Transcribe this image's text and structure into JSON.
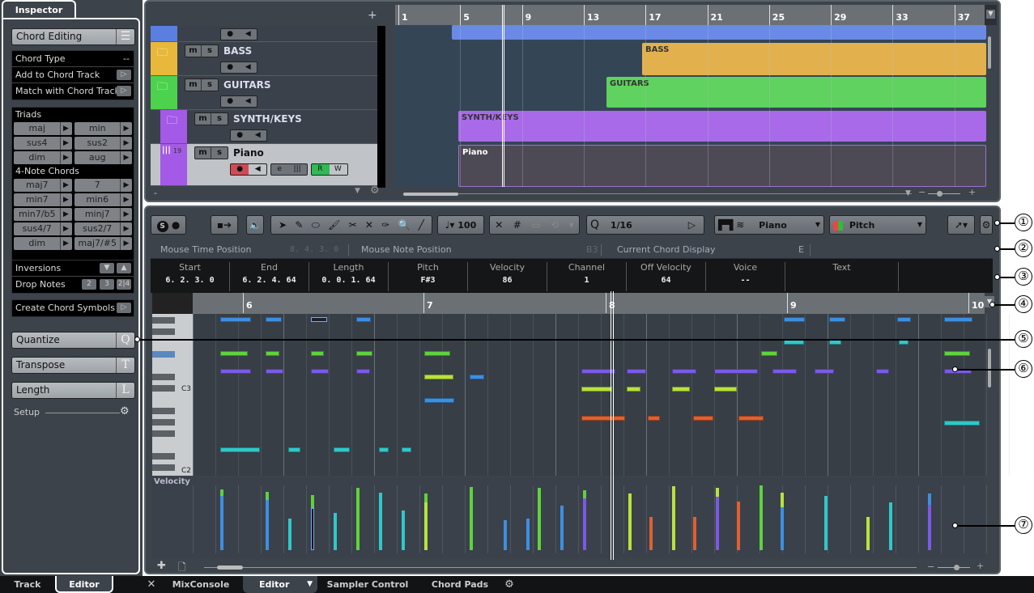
{
  "inspector": {
    "tab_label": "Inspector",
    "section_button": "Chord Editing",
    "chord_type_label": "Chord Type",
    "chord_type_value": "--",
    "add_to_chord_track": "Add to Chord Track",
    "match_with_chord_track": "Match with Chord Track",
    "triads_label": "Triads",
    "triads": [
      "maj",
      "min",
      "sus4",
      "sus2",
      "dim",
      "aug"
    ],
    "four_note_label": "4-Note Chords",
    "four_note_chords": [
      "maj7",
      "7",
      "min7",
      "min6",
      "min7/b5",
      "minj7",
      "sus4/7",
      "sus2/7",
      "dim",
      "maj7/#5"
    ],
    "inversions_label": "Inversions",
    "drop_notes_label": "Drop Notes",
    "drop_notes_options": [
      "2",
      "3",
      "2|4"
    ],
    "create_chord_symbols": "Create Chord Symbols",
    "quantize": {
      "label": "Quantize",
      "key": "Q"
    },
    "transpose": {
      "label": "Transpose",
      "key": "T"
    },
    "length": {
      "label": "Length",
      "key": "L"
    },
    "setup_label": "Setup"
  },
  "bottom_tabs": {
    "left": [
      "Track",
      "Editor"
    ],
    "left_active": "Editor",
    "right": [
      "MixConsole",
      "Editor",
      "Sampler Control",
      "Chord Pads"
    ],
    "right_active": "Editor"
  },
  "project": {
    "tracks": [
      {
        "name": "",
        "color": "#5b7fe0",
        "type": "midi"
      },
      {
        "name": "BASS",
        "color": "#e8b83c",
        "type": "folder"
      },
      {
        "name": "GUITARS",
        "color": "#4cd24c",
        "type": "folder"
      },
      {
        "name": "SYNTH/KEYS",
        "color": "#a35ae6",
        "type": "folder-open"
      },
      {
        "name": "Piano",
        "color": "#a35ae6",
        "type": "instrument",
        "number": "19",
        "selected": true
      }
    ],
    "mute_label": "m",
    "solo_label": "s",
    "read_label": "R",
    "write_label": "W",
    "ruler_bars": [
      "1",
      "5",
      "9",
      "13",
      "17",
      "21",
      "25",
      "29",
      "33",
      "37"
    ],
    "parts": [
      {
        "label": "",
        "color": "#6a8ae6"
      },
      {
        "label": "BASS",
        "color": "#e2b14e"
      },
      {
        "label": "GUITARS",
        "color": "#5fd25f"
      },
      {
        "label": "SYNTH/KEYS",
        "color": "#a86ae8"
      },
      {
        "label": "Piano",
        "color": "#4e4a55"
      }
    ]
  },
  "editor": {
    "toolbar": {
      "solo_editor": "S",
      "velocity_value": "100",
      "quantize_label": "Q",
      "quantize_value": "1/16",
      "track_select": "Piano",
      "color_scheme": "Pitch"
    },
    "status_line": {
      "mouse_time_label": "Mouse Time Position",
      "mouse_time_value": "8. 4. 3.   0",
      "mouse_note_label": "Mouse Note Position",
      "mouse_note_value": "B3",
      "chord_display_label": "Current Chord Display",
      "chord_display_value": "E"
    },
    "info_line": [
      {
        "label": "Start",
        "value": "6. 2. 3.   0"
      },
      {
        "label": "End",
        "value": "6. 2. 4. 64"
      },
      {
        "label": "Length",
        "value": "0. 0. 1. 64"
      },
      {
        "label": "Pitch",
        "value": "F#3"
      },
      {
        "label": "Velocity",
        "value": "86"
      },
      {
        "label": "Channel",
        "value": "1"
      },
      {
        "label": "Off Velocity",
        "value": "64"
      },
      {
        "label": "Voice",
        "value": "--"
      },
      {
        "label": "Text",
        "value": ""
      }
    ],
    "ruler_bars": [
      "6",
      "7",
      "8",
      "9",
      "10"
    ],
    "key_labels": [
      "C3",
      "C2"
    ],
    "velocity_lane_label": "Velocity",
    "colors": {
      "blue": "#3d8fe0",
      "green": "#5fd23c",
      "purple": "#7a5ae6",
      "cyan": "#2fc8c8",
      "lime": "#b8e23c",
      "orange": "#e0602f"
    }
  },
  "callouts": [
    "①",
    "②",
    "③",
    "④",
    "⑤",
    "⑥",
    "⑦"
  ]
}
